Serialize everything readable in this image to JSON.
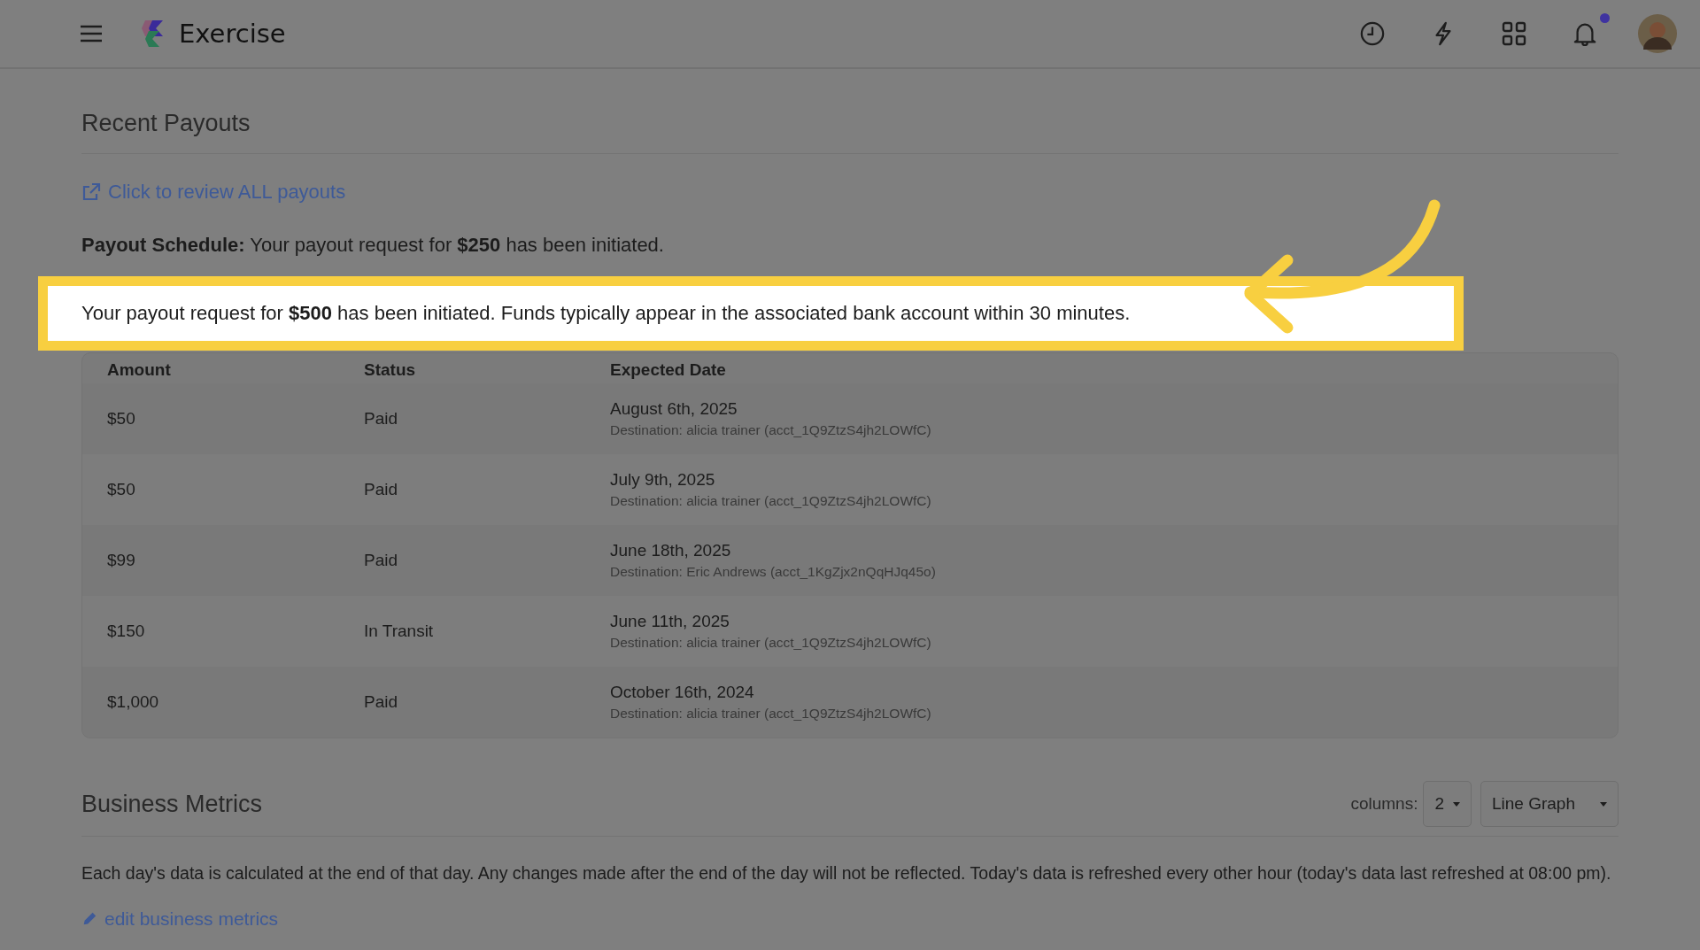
{
  "header": {
    "app_name": "Exercise",
    "notifications": {
      "unread": true
    }
  },
  "recent_payouts": {
    "title": "Recent Payouts",
    "review_link": "Click to review ALL payouts",
    "schedule": "**Payout Schedule:** Your payout request for **$250** has been initiated.",
    "notice": "Your payout request for **$500** has been initiated. Funds typically appear in the associated bank account within 30 minutes.",
    "columns": [
      "Amount",
      "Status",
      "Expected Date"
    ],
    "rows": [
      {
        "amount": "$50",
        "status": "Paid",
        "date": "August 6th, 2025",
        "destination": "Destination: alicia trainer (acct_1Q9ZtzS4jh2LOWfC)"
      },
      {
        "amount": "$50",
        "status": "Paid",
        "date": "July 9th, 2025",
        "destination": "Destination: alicia trainer (acct_1Q9ZtzS4jh2LOWfC)"
      },
      {
        "amount": "$99",
        "status": "Paid",
        "date": "June 18th, 2025",
        "destination": "Destination: Eric Andrews (acct_1KgZjx2nQqHJq45o)"
      },
      {
        "amount": "$150",
        "status": "In Transit",
        "date": "June 11th, 2025",
        "destination": "Destination: alicia trainer (acct_1Q9ZtzS4jh2LOWfC)"
      },
      {
        "amount": "$1,000",
        "status": "Paid",
        "date": "October 16th, 2024",
        "destination": "Destination: alicia trainer (acct_1Q9ZtzS4jh2LOWfC)"
      }
    ]
  },
  "business_metrics": {
    "title": "Business Metrics",
    "columns_label": "columns:",
    "columns_value": "2",
    "view": "Line Graph",
    "description": "Each day's data is calculated at the end of that day. Any changes made after the end of the day will not be reflected. Today's data is refreshed every other hour (today's data last refreshed at 08:00 pm).",
    "edit_link": "edit business metrics"
  }
}
